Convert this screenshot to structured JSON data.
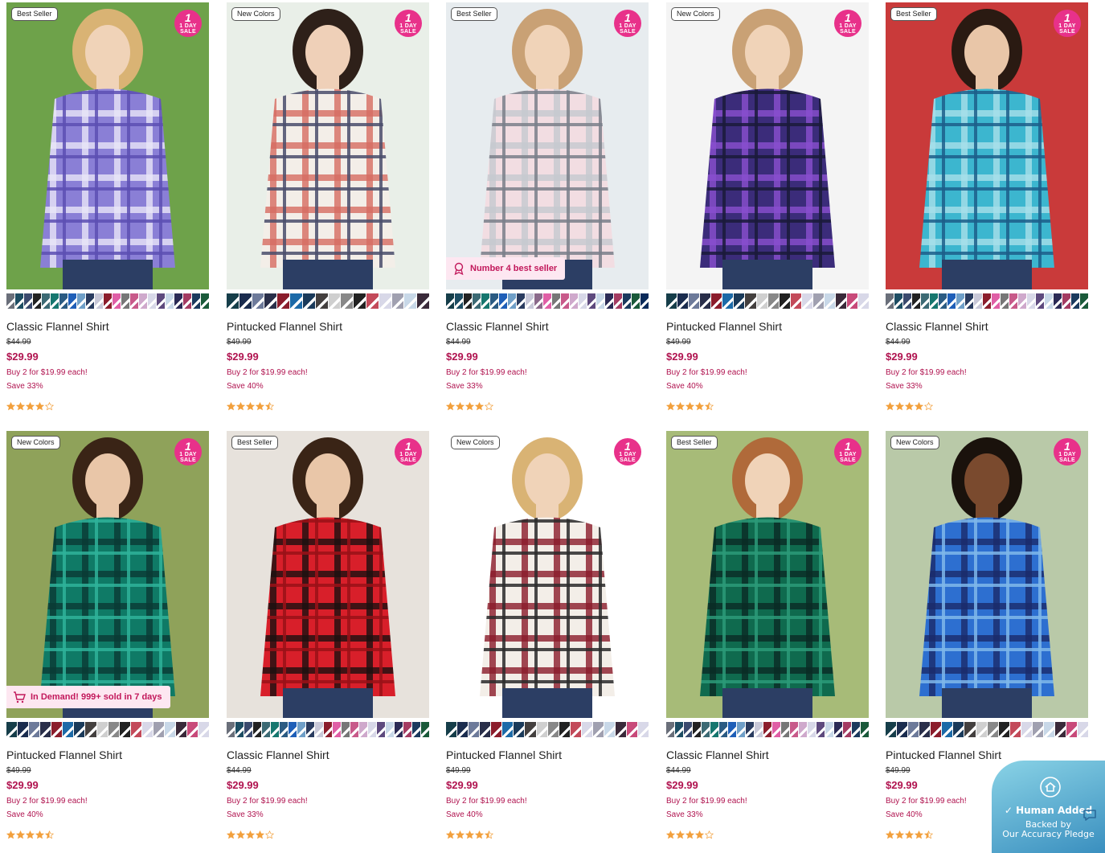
{
  "products": [
    {
      "name": "Classic Flannel Shirt",
      "orig": "$44.99",
      "price": "$29.99",
      "promo": "Buy 2 for $19.99 each!",
      "save": "Save 33%",
      "rating": 4.0,
      "badge": "Best Seller",
      "sale_badge": "1 DAY SALE",
      "plaid": [
        "#8a7fd6",
        "#e9e6f7",
        "#5c4fb3"
      ],
      "bg": "#6ea24a",
      "person": "#f0d3b8",
      "hair": "#d9b374",
      "extra_tag": null,
      "swatches": [
        "#6a6f7a",
        "#1d4d63",
        "#3b4a6e",
        "#222",
        "#3c6a74",
        "#16776f",
        "#2b5b83",
        "#1f5fb8",
        "#6f9fc8",
        "#2a3c60",
        "#c8c8d8",
        "#8b1d2c",
        "#e05fa6",
        "#777",
        "#c85a8a",
        "#cfa9cc",
        "#d8d8e8",
        "#5e4a7e",
        "#c8d8e8",
        "#2b2b56",
        "#a43b62",
        "#1b3a5e",
        "#1a5a3a"
      ]
    },
    {
      "name": "Pintucked Flannel Shirt",
      "orig": "$49.99",
      "price": "$29.99",
      "promo": "Buy 2 for $19.99 each!",
      "save": "Save 40%",
      "rating": 4.5,
      "badge": "New Colors",
      "sale_badge": "1 DAY SALE",
      "plaid": [
        "#f3eee8",
        "#d66c62",
        "#4a4e6b"
      ],
      "bg": "#e9efe8",
      "person": "#efd0b8",
      "hair": "#2e2019",
      "extra_tag": null,
      "swatches": [
        "#163e4a",
        "#1b2d4f",
        "#6d7a9a",
        "#2a2f4a",
        "#8b1d2c",
        "#1c6aa8",
        "#1a3a5a",
        "#44403f",
        "#cfcfcf",
        "#888",
        "#222",
        "#c34a5a",
        "#d8d8e8",
        "#a0a0b0",
        "#c8d8e8",
        "#3a2a3a"
      ]
    },
    {
      "name": "Classic Flannel Shirt",
      "orig": "$44.99",
      "price": "$29.99",
      "promo": "Buy 2 for $19.99 each!",
      "save": "Save 33%",
      "rating": 4.0,
      "badge": "Best Seller",
      "sale_badge": "1 DAY SALE",
      "plaid": [
        "#f2dde2",
        "#c6c9cf",
        "#7a7f8a"
      ],
      "bg": "#e7ecef",
      "person": "#f0d3b8",
      "hair": "#c9a175",
      "extra_tag": "Number 4 best seller",
      "swatches": [
        "#163e4a",
        "#1d4d63",
        "#222",
        "#3c6a74",
        "#16776f",
        "#2b5b83",
        "#1f5fb8",
        "#6f9fc8",
        "#2a3c60",
        "#c8c8d8",
        "#8b6a8b",
        "#e05fa6",
        "#777",
        "#c85a8a",
        "#cfa9cc",
        "#d8d8e8",
        "#5e4a7e",
        "#c8d8e8",
        "#2b2b56",
        "#a43b62",
        "#1b3a5e",
        "#1a5a3a",
        "#0a2a5a"
      ]
    },
    {
      "name": "Pintucked Flannel Shirt",
      "orig": "$49.99",
      "price": "$29.99",
      "promo": "Buy 2 for $19.99 each!",
      "save": "Save 40%",
      "rating": 4.5,
      "badge": "New Colors",
      "sale_badge": "1 DAY SALE",
      "plaid": [
        "#3b2c7a",
        "#8a4fd0",
        "#1a1a3a"
      ],
      "bg": "#f4f4f4",
      "person": "#f0d3b8",
      "hair": "#c9a175",
      "extra_tag": null,
      "swatches": [
        "#163e4a",
        "#1b2d4f",
        "#6d7a9a",
        "#2a2f4a",
        "#8b1d2c",
        "#1c6aa8",
        "#1a3a5a",
        "#44403f",
        "#cfcfcf",
        "#888",
        "#222",
        "#c34a5a",
        "#d8d8e8",
        "#a0a0b0",
        "#c8d8e8",
        "#3a2a3a",
        "#c84a7a",
        "#d8d8e8"
      ]
    },
    {
      "name": "Classic Flannel Shirt",
      "orig": "$44.99",
      "price": "$29.99",
      "promo": "Buy 2 for $19.99 each!",
      "save": "Save 33%",
      "rating": 4.0,
      "badge": "Best Seller",
      "sale_badge": "1 DAY SALE",
      "plaid": [
        "#3cb6cf",
        "#a7e0ea",
        "#1c5e8a"
      ],
      "bg": "#c93a3a",
      "person": "#e9c6a8",
      "hair": "#2a1a12",
      "extra_tag": null,
      "swatches": [
        "#6a6f7a",
        "#1d4d63",
        "#3b4a6e",
        "#222",
        "#3c6a74",
        "#16776f",
        "#2b5b83",
        "#1f5fb8",
        "#6f9fc8",
        "#2a3c60",
        "#c8c8d8",
        "#8b1d2c",
        "#e05fa6",
        "#777",
        "#c85a8a",
        "#cfa9cc",
        "#d8d8e8",
        "#5e4a7e",
        "#c8d8e8",
        "#2b2b56",
        "#a43b62",
        "#1b3a5e",
        "#1a5a3a"
      ]
    },
    {
      "name": "Pintucked Flannel Shirt",
      "orig": "$49.99",
      "price": "$29.99",
      "promo": "Buy 2 for $19.99 each!",
      "save": "Save 40%",
      "rating": 4.5,
      "badge": "New Colors",
      "sale_badge": "1 DAY SALE",
      "plaid": [
        "#0f7a66",
        "#0a3a34",
        "#2fb39a"
      ],
      "bg": "#8fa25a",
      "person": "#e9c6a8",
      "hair": "#3a2416",
      "extra_tag": "In Demand! 999+ sold in 7 days",
      "swatches": [
        "#163e4a",
        "#1b2d4f",
        "#6d7a9a",
        "#2a2f4a",
        "#8b1d2c",
        "#1c6aa8",
        "#1a3a5a",
        "#44403f",
        "#cfcfcf",
        "#888",
        "#222",
        "#c34a5a",
        "#d8d8e8",
        "#a0a0b0",
        "#c8d8e8",
        "#3a2a3a",
        "#c84a7a",
        "#d8d8e8"
      ]
    },
    {
      "name": "Classic Flannel Shirt",
      "orig": "$44.99",
      "price": "$29.99",
      "promo": "Buy 2 for $19.99 each!",
      "save": "Save 33%",
      "rating": 4.0,
      "badge": "Best Seller",
      "sale_badge": "1 DAY SALE",
      "plaid": [
        "#d81f2a",
        "#1a1010",
        "#9a1018"
      ],
      "bg": "#e7e2dc",
      "person": "#e9c6a8",
      "hair": "#3a2416",
      "extra_tag": null,
      "swatches": [
        "#6a6f7a",
        "#1d4d63",
        "#3b4a6e",
        "#222",
        "#3c6a74",
        "#16776f",
        "#2b5b83",
        "#1f5fb8",
        "#6f9fc8",
        "#2a3c60",
        "#c8c8d8",
        "#8b1d2c",
        "#e05fa6",
        "#777",
        "#c85a8a",
        "#cfa9cc",
        "#d8d8e8",
        "#5e4a7e",
        "#c8d8e8",
        "#2b2b56",
        "#a43b62",
        "#1b3a5e",
        "#1a5a3a"
      ]
    },
    {
      "name": "Pintucked Flannel Shirt",
      "orig": "$49.99",
      "price": "$29.99",
      "promo": "Buy 2 for $19.99 each!",
      "save": "Save 40%",
      "rating": 4.5,
      "badge": "New Colors",
      "sale_badge": "1 DAY SALE",
      "plaid": [
        "#f3eee8",
        "#8a1a2a",
        "#2a2a2a"
      ],
      "bg": "#ffffff",
      "person": "#f0d3b8",
      "hair": "#d9b374",
      "extra_tag": null,
      "swatches": [
        "#163e4a",
        "#1b2d4f",
        "#6d7a9a",
        "#2a2f4a",
        "#8b1d2c",
        "#1c6aa8",
        "#1a3a5a",
        "#44403f",
        "#cfcfcf",
        "#888",
        "#222",
        "#c34a5a",
        "#d8d8e8",
        "#a0a0b0",
        "#c8d8e8",
        "#3a2a3a",
        "#c84a7a",
        "#d8d8e8"
      ]
    },
    {
      "name": "Classic Flannel Shirt",
      "orig": "$44.99",
      "price": "$29.99",
      "promo": "Buy 2 for $19.99 each!",
      "save": "Save 33%",
      "rating": 4.0,
      "badge": "Best Seller",
      "sale_badge": "1 DAY SALE",
      "plaid": [
        "#0f6a4e",
        "#0a2a24",
        "#2b9a78"
      ],
      "bg": "#a7bb78",
      "person": "#f0d3b8",
      "hair": "#b06a3a",
      "extra_tag": null,
      "swatches": [
        "#6a6f7a",
        "#1d4d63",
        "#3b4a6e",
        "#222",
        "#3c6a74",
        "#16776f",
        "#2b5b83",
        "#1f5fb8",
        "#6f9fc8",
        "#2a3c60",
        "#c8c8d8",
        "#8b1d2c",
        "#e05fa6",
        "#777",
        "#c85a8a",
        "#cfa9cc",
        "#d8d8e8",
        "#5e4a7e",
        "#c8d8e8",
        "#2b2b56",
        "#a43b62",
        "#1b3a5e",
        "#1a5a3a"
      ]
    },
    {
      "name": "Pintucked Flannel Shirt",
      "orig": "$49.99",
      "price": "$29.99",
      "promo": "Buy 2 for $19.99 each!",
      "save": "Save 40%",
      "rating": 4.5,
      "badge": "New Colors",
      "sale_badge": "1 DAY SALE",
      "plaid": [
        "#2d6fd0",
        "#1a2a6a",
        "#7fb7ea"
      ],
      "bg": "#b9c9a8",
      "person": "#7a4a2e",
      "hair": "#1a120c",
      "extra_tag": null,
      "swatches": [
        "#163e4a",
        "#1b2d4f",
        "#6d7a9a",
        "#2a2f4a",
        "#8b1d2c",
        "#1c6aa8",
        "#1a3a5a",
        "#44403f",
        "#cfcfcf",
        "#888",
        "#222",
        "#c34a5a",
        "#d8d8e8",
        "#a0a0b0",
        "#c8d8e8",
        "#3a2a3a",
        "#c84a7a",
        "#d8d8e8"
      ]
    }
  ],
  "pledge": {
    "title": "Human Added",
    "line1": "Backed by",
    "line2": "Our Accuracy Pledge",
    "color_start": "#8ad3e6",
    "color_end": "#3a8fbf"
  },
  "colors": {
    "price": "#b0134f",
    "sale_badge": "#e8318a",
    "star": "#f2a03d",
    "promo_tag_bg": "#fde7f1"
  }
}
